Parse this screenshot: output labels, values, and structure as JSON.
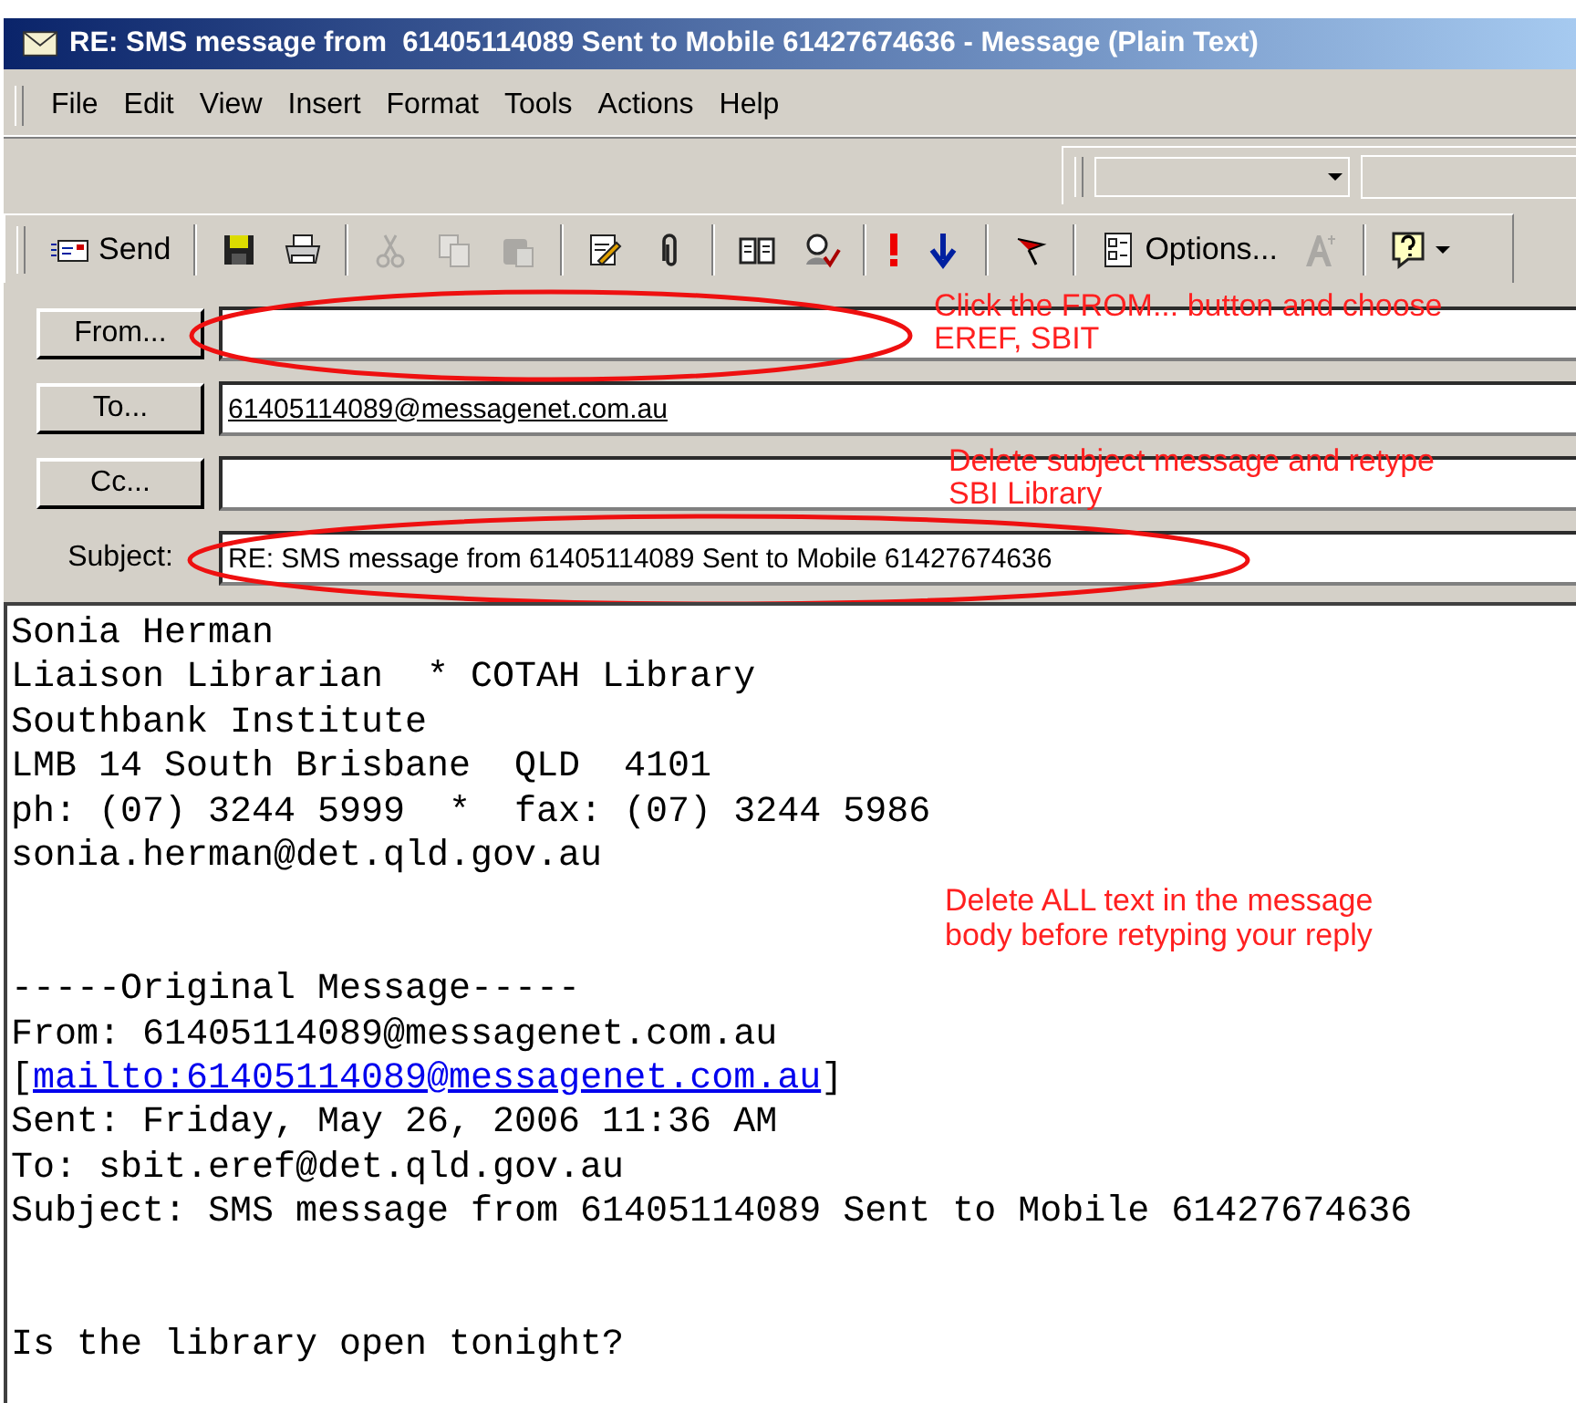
{
  "window": {
    "title": "RE: SMS message from  61405114089 Sent to Mobile 61427674636 - Message (Plain Text)"
  },
  "menu": [
    {
      "label": "File"
    },
    {
      "label": "Edit"
    },
    {
      "label": "View"
    },
    {
      "label": "Insert"
    },
    {
      "label": "Format"
    },
    {
      "label": "Tools"
    },
    {
      "label": "Actions"
    },
    {
      "label": "Help"
    }
  ],
  "toolbar": [
    {
      "kind": "send",
      "label": "Send"
    },
    {
      "kind": "separator"
    },
    {
      "kind": "save",
      "disabled": false
    },
    {
      "kind": "print",
      "disabled": false
    },
    {
      "kind": "separator"
    },
    {
      "kind": "cut",
      "disabled": true
    },
    {
      "kind": "copy",
      "disabled": true
    },
    {
      "kind": "paste",
      "disabled": true
    },
    {
      "kind": "separator"
    },
    {
      "kind": "signature",
      "disabled": false
    },
    {
      "kind": "attach",
      "disabled": false
    },
    {
      "kind": "separator"
    },
    {
      "kind": "book",
      "disabled": false
    },
    {
      "kind": "check",
      "disabled": false
    },
    {
      "kind": "separator"
    },
    {
      "kind": "high",
      "disabled": false
    },
    {
      "kind": "low",
      "disabled": false
    },
    {
      "kind": "separator"
    },
    {
      "kind": "flag",
      "disabled": false
    },
    {
      "kind": "separator"
    },
    {
      "kind": "options",
      "label": "Options..."
    },
    {
      "kind": "font",
      "disabled": true
    },
    {
      "kind": "separator"
    },
    {
      "kind": "help",
      "disabled": false
    }
  ],
  "fields": [
    {
      "kind": "button",
      "label": "From...",
      "circled": true
    },
    {
      "kind": "button",
      "label": "To...",
      "value": "61405114089@messagenet.com.au",
      "resolved": true,
      "circled": false
    },
    {
      "kind": "button",
      "label": "Cc...",
      "circled": false
    },
    {
      "kind": "label",
      "label": "Subject:",
      "value": "RE: SMS message from  61405114089 Sent to Mobile 61427674636",
      "resolved": false,
      "circled": true
    }
  ],
  "field_notes": [
    "Click the FROM... button and choose\nEREF, SBIT",
    "Delete subject message and retype\nSBI Library"
  ],
  "body": {
    "lines": [
      {
        "kind": "text",
        "text": "Sonia Herman"
      },
      {
        "kind": "text",
        "text": "Liaison Librarian  * COTAH Library"
      },
      {
        "kind": "text",
        "text": "Southbank Institute"
      },
      {
        "kind": "text",
        "text": "LMB 14 South Brisbane  QLD  4101"
      },
      {
        "kind": "text",
        "text": "ph: (07) 3244 5999  *  fax: (07) 3244 5986"
      },
      {
        "kind": "text",
        "text": "sonia.herman@det.qld.gov.au"
      },
      {
        "kind": "blank"
      },
      {
        "kind": "blank"
      },
      {
        "kind": "text",
        "text": "-----Original Message-----"
      },
      {
        "kind": "text",
        "text": "From: 61405114089@messagenet.com.au"
      },
      {
        "kind": "link",
        "before": "[",
        "link": "mailto:61405114089@messagenet.com.au",
        "after": "]"
      },
      {
        "kind": "text",
        "text": "Sent: Friday, May 26, 2006 11:36 AM"
      },
      {
        "kind": "text",
        "text": "To: sbit.eref@det.qld.gov.au"
      },
      {
        "kind": "text",
        "text": "Subject: SMS message from 61405114089 Sent to Mobile 61427674636"
      },
      {
        "kind": "blank"
      },
      {
        "kind": "blank"
      },
      {
        "kind": "text",
        "text": "Is the library open tonight?"
      }
    ],
    "note": "Delete ALL text in the message\nbody before retyping your reply"
  }
}
